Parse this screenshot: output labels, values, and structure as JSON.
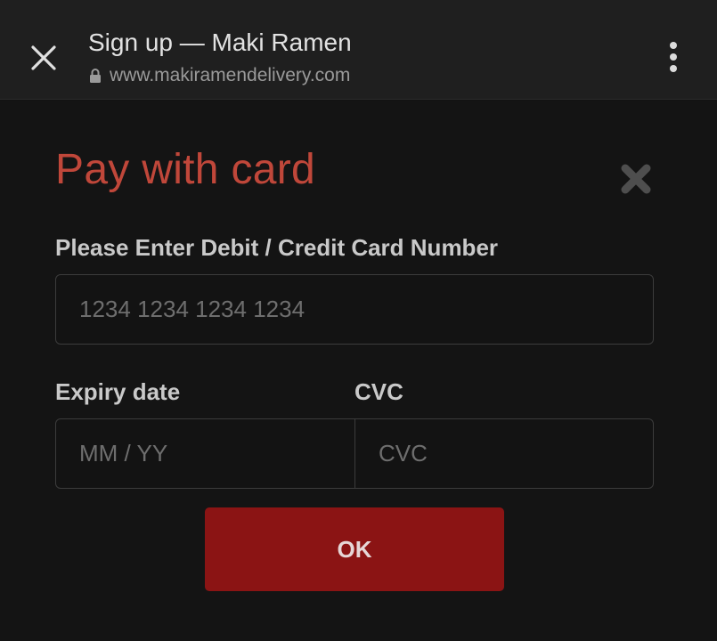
{
  "browser": {
    "close_icon": "close-icon",
    "title": "Sign up — Maki Ramen",
    "lock_icon": "lock-icon",
    "url": "www.makiramendelivery.com",
    "menu_icon": "more-vert-icon"
  },
  "dialog": {
    "heading": "Pay with card",
    "close_icon": "close-icon",
    "card_label": "Please Enter Debit / Credit Card Number",
    "card_placeholder": "1234 1234 1234 1234",
    "card_value": "",
    "expiry_label": "Expiry date",
    "expiry_placeholder": "MM / YY",
    "expiry_value": "",
    "cvc_label": "CVC",
    "cvc_placeholder": "CVC",
    "cvc_value": "",
    "ok_label": "OK"
  },
  "colors": {
    "heading": "#c0473a",
    "ok_button": "#8b1414",
    "background": "#141414",
    "topbar": "#1f1f1f"
  }
}
